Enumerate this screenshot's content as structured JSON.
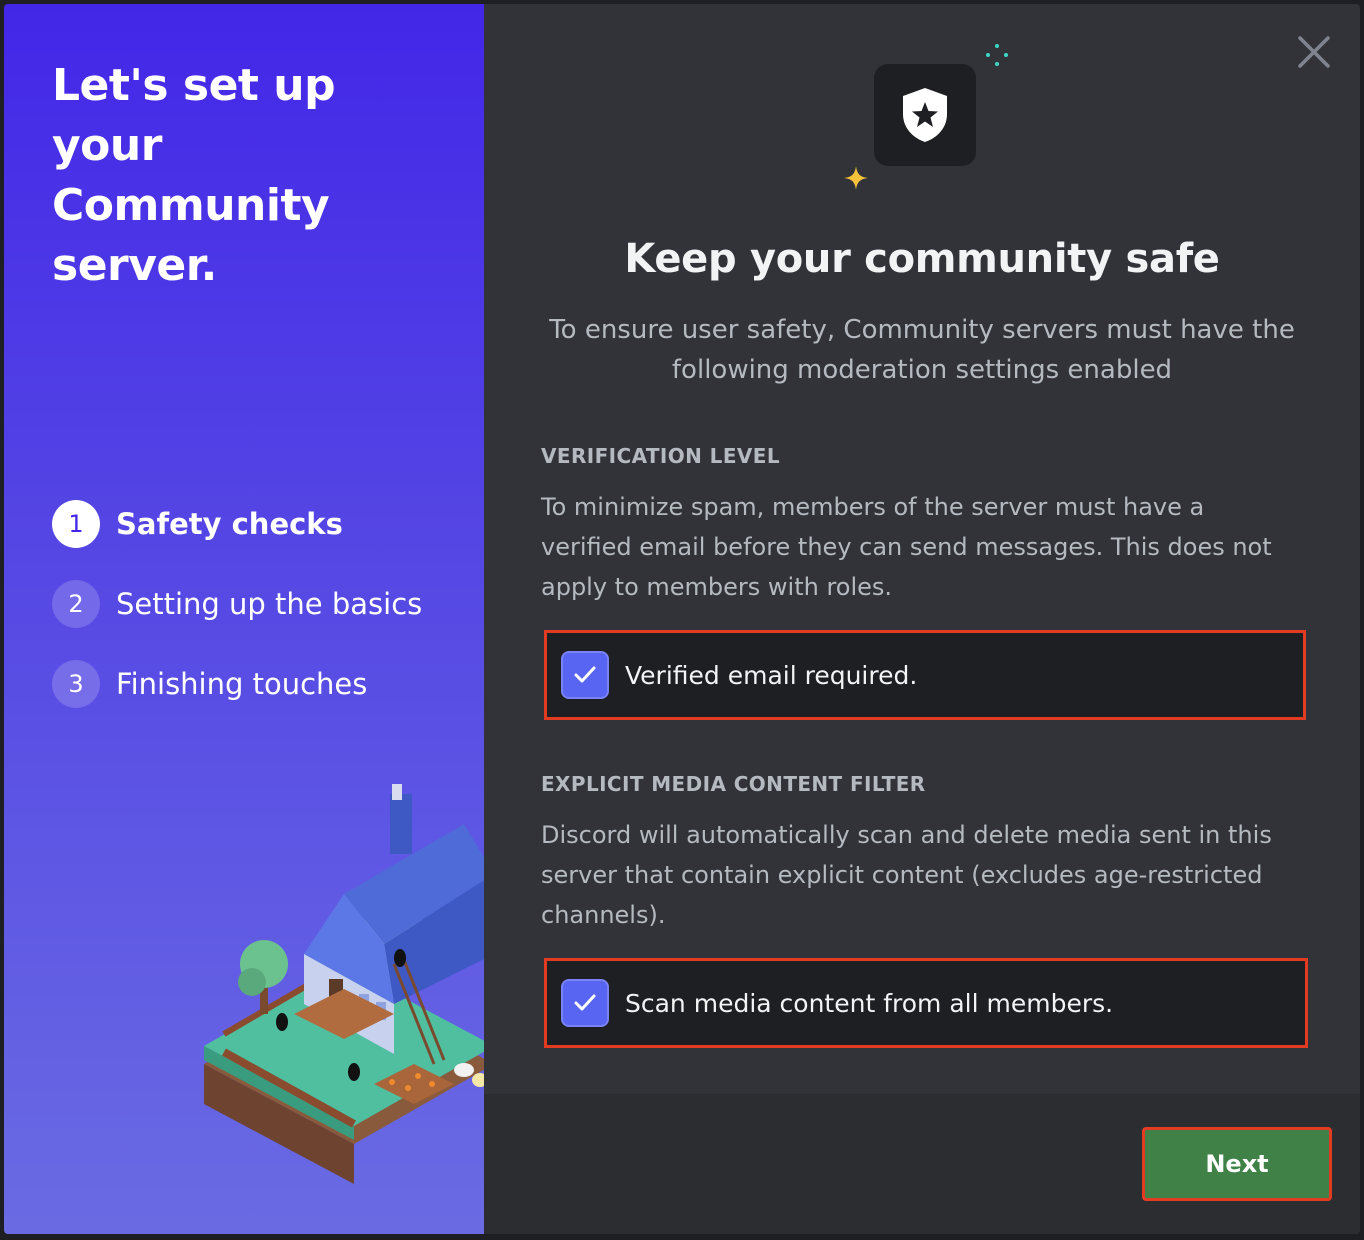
{
  "left": {
    "title": "Let's set up your Community server.",
    "steps": [
      {
        "num": "1",
        "label": "Safety checks",
        "active": true
      },
      {
        "num": "2",
        "label": "Setting up the basics",
        "active": false
      },
      {
        "num": "3",
        "label": "Finishing touches",
        "active": false
      }
    ]
  },
  "main": {
    "hero_icon": "shield-star-icon",
    "title": "Keep your community safe",
    "subtitle": "To ensure user safety, Community servers must have the following moderation settings enabled",
    "verification": {
      "heading": "VERIFICATION LEVEL",
      "description": "To minimize spam, members of the server must have a verified email before they can send messages. This does not apply to members with roles.",
      "checkbox_label": "Verified email required.",
      "checked": true
    },
    "media_filter": {
      "heading": "EXPLICIT MEDIA CONTENT FILTER",
      "description": "Discord will automatically scan and delete media sent in this server that contain explicit content (excludes age-restricted channels).",
      "checkbox_label": "Scan media content from all members.",
      "checked": true
    }
  },
  "footer": {
    "next_label": "Next"
  },
  "colors": {
    "brand": "#5865f2",
    "left_gradient_top": "#4327e8",
    "next_button": "#3f8147",
    "highlight_border": "#e23b22"
  }
}
